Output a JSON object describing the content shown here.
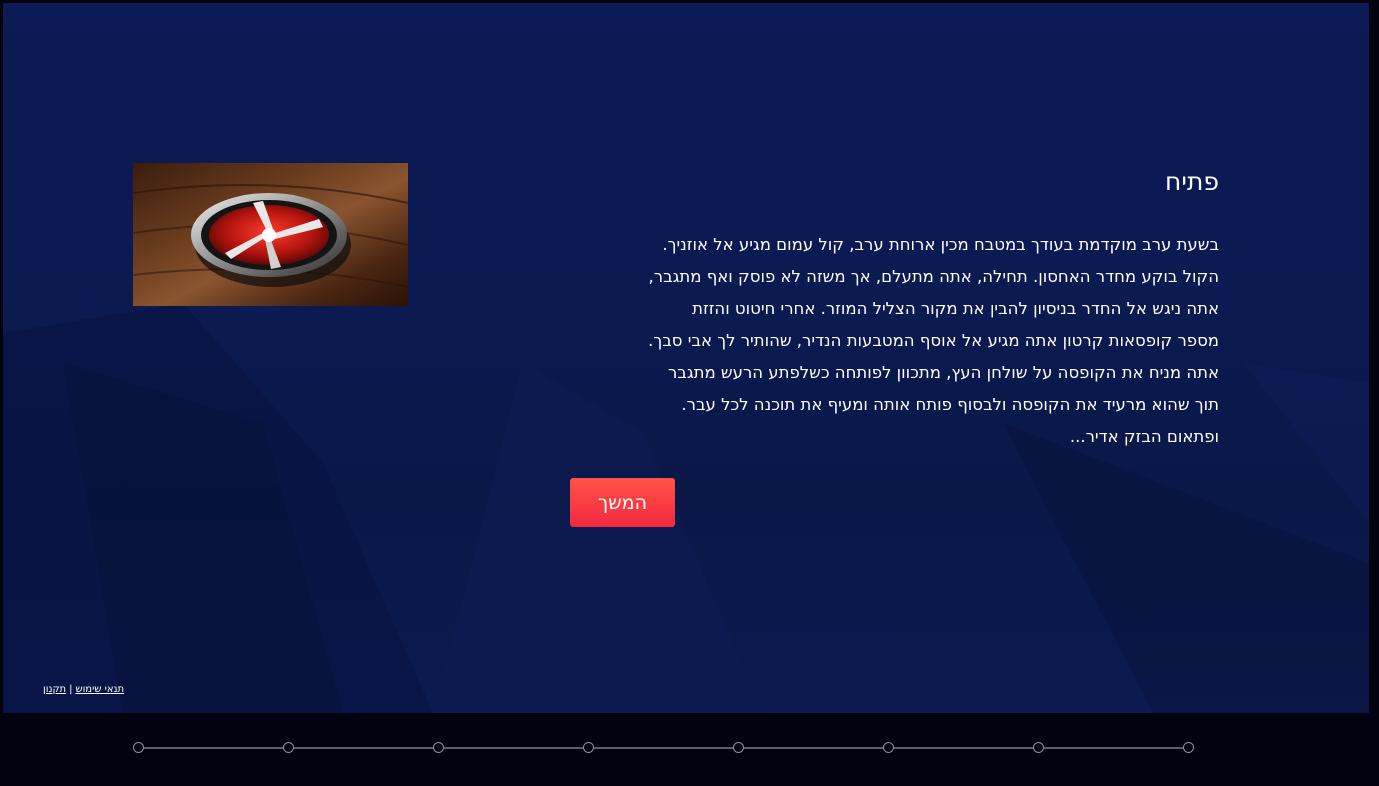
{
  "intro": {
    "title": "פתיח",
    "body": "בשעת ערב מוקדמת בעודך במטבח מכין ארוחת ערב, קול עמום מגיע אל אוזניך.\nהקול בוקע מחדר האחסון. תחילה, אתה מתעלם, אך משזה לא פוסק ואף מתגבר,\nאתה ניגש אל החדר בניסיון להבין את מקור הצליל המוזר. אחרי חיטוט והזזת\nמספר קופסאות קרטון אתה מגיע אל אוסף המטבעות הנדיר, שהותיר לך אבי סבך.\nאתה מניח את הקופסה על שולחן העץ, מתכוון לפותחה כשלפתע הרעש מתגבר\nתוך שהוא מרעיד את הקופסה ולבסוף פותח אותה ומעיף את תוכנה לכל עבר.\nופתאום הבזק אדיר...",
    "continue_label": "המשך"
  },
  "image": {
    "icon": "glowing-coin-emblem-icon"
  },
  "footer": {
    "terms_label": "תנאי שימוש",
    "separator": "|",
    "rules_label": "תקנון"
  },
  "progress": {
    "steps": 8,
    "current_step": 0
  },
  "colors": {
    "background": "#0b1a52",
    "bottom_bar": "#02030f",
    "button_top": "#ff5446",
    "button_bottom": "#f4283f",
    "text": "#ffffff"
  }
}
